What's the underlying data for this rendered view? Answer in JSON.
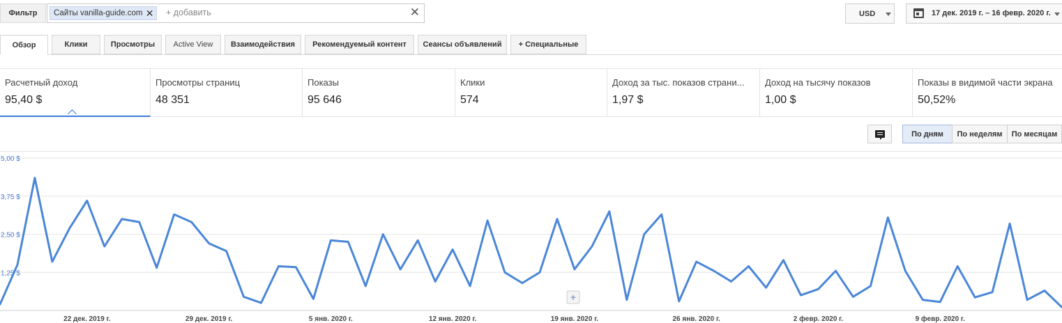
{
  "filter": {
    "button_label": "Фильтр",
    "chip_label": "Сайты vanilla-guide.com",
    "add_placeholder": "+ добавить"
  },
  "currency": {
    "selected": "USD"
  },
  "date_range": {
    "label": "17 дек. 2019 г. – 16 февр. 2020 г."
  },
  "tabs": [
    {
      "label": "Обзор",
      "active": true
    },
    {
      "label": "Клики"
    },
    {
      "label": "Просмотры"
    },
    {
      "label": "Active View"
    },
    {
      "label": "Взаимодействия"
    },
    {
      "label": "Рекомендуемый контент"
    },
    {
      "label": "Сеансы объявлений"
    },
    {
      "label": "+  Специальные"
    }
  ],
  "scorecards": [
    {
      "label": "Расчетный доход",
      "value": "95,40 $",
      "active": true
    },
    {
      "label": "Просмотры страниц",
      "value": "48 351"
    },
    {
      "label": "Показы",
      "value": "95 646"
    },
    {
      "label": "Клики",
      "value": "574"
    },
    {
      "label": "Доход за тыс. показов страни...",
      "value": "1,97 $"
    },
    {
      "label": "Доход на тысячу показов",
      "value": "1,00 $"
    },
    {
      "label": "Показы в видимой части экрана",
      "value": "50,52%"
    }
  ],
  "granularity": {
    "options": [
      "По дням",
      "По неделям",
      "По месяцам"
    ],
    "selected": "По дням"
  },
  "icons": {
    "filter_remove": "close-icon",
    "filter_clear": "close-icon",
    "date": "calendar-icon",
    "annotation": "comment-icon",
    "add_annotation": "plus-icon"
  },
  "colors": {
    "series": "#4a86d8",
    "accent": "#3b78d8"
  },
  "chart_data": {
    "type": "line",
    "series": [
      {
        "values": [
          0.2,
          1.5,
          4.35,
          1.6,
          2.7,
          3.6,
          2.1,
          3.0,
          2.9,
          1.4,
          3.15,
          2.9,
          2.2,
          1.95,
          0.45,
          0.25,
          1.45,
          1.42,
          0.38,
          2.3,
          2.25,
          0.8,
          2.5,
          1.35,
          2.3,
          0.95,
          2.0,
          0.8,
          2.95,
          1.25,
          0.9,
          1.25,
          3.0,
          1.35,
          2.1,
          3.25,
          0.35,
          2.5,
          3.15,
          0.3,
          1.6,
          1.3,
          0.95,
          1.45,
          0.75,
          1.65,
          0.5,
          0.7,
          1.3,
          0.45,
          0.8,
          3.05,
          1.3,
          0.35,
          0.28,
          1.45,
          0.43,
          0.6,
          2.85,
          0.35,
          0.65,
          0.1
        ]
      }
    ],
    "ylim": [
      0,
      5
    ],
    "ytick_labels": [
      "5,00 $",
      "3,75 $",
      "2,50 $",
      "1,25 $"
    ],
    "yticks": [
      5,
      3.75,
      2.5,
      1.25
    ],
    "xtick_labels": [
      "22 дек. 2019 г.",
      "29 дек. 2019 г.",
      "5 янв. 2020 г.",
      "12 янв. 2020 г.",
      "19 янв. 2020 г.",
      "26 янв. 2020 г.",
      "2 февр. 2020 г.",
      "9 февр. 2020 г."
    ],
    "xtick_index": [
      5,
      12,
      19,
      26,
      33,
      40,
      47,
      54
    ],
    "grid": true
  }
}
